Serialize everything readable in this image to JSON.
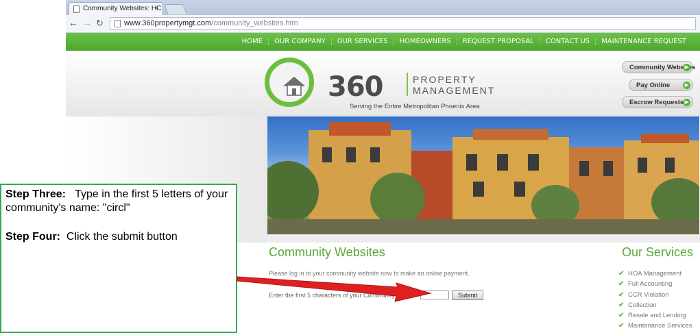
{
  "browser": {
    "tab_title": "Community Websites: HC",
    "tab_close": "×",
    "url_domain": "www.360propertymgt.com",
    "url_path": "/community_websites.htm"
  },
  "nav": {
    "items": [
      "HOME",
      "OUR COMPANY",
      "OUR SERVICES",
      "HOMEOWNERS",
      "REQUEST PROPOSAL",
      "CONTACT US",
      "MAINTENANCE REQUEST"
    ]
  },
  "logo": {
    "number": "360",
    "word1": "PROPERTY",
    "word2": "MANAGEMENT",
    "tagline": "Serving the Entire Metropolitan Phoenix Area"
  },
  "side_buttons": {
    "community": "Community Websites",
    "pay": "Pay Online",
    "escrow": "Escrow Requests"
  },
  "content": {
    "title": "Community Websites",
    "intro": "Please log in to your community website now to make an online payment.",
    "label": "Enter the first 5 characters of your Community Name:",
    "submit": "Submit"
  },
  "services": {
    "title": "Our Services",
    "items": [
      "HOA Management",
      "Full Accounting",
      "CCR Violation",
      "Collection",
      "Resale and Lending",
      "Maintenance Services"
    ]
  },
  "callout": {
    "step_three_heading": "Step Three:",
    "step_three_text": "Type in the first 5 letters of your community's name: \"circl\"",
    "step_four_heading": "Step Four:",
    "step_four_text": "Click the submit button"
  },
  "colors": {
    "brand_green": "#5aa637",
    "nav_green": "#4ea62e",
    "arrow_red": "#e02020",
    "callout_border": "#34a853"
  }
}
